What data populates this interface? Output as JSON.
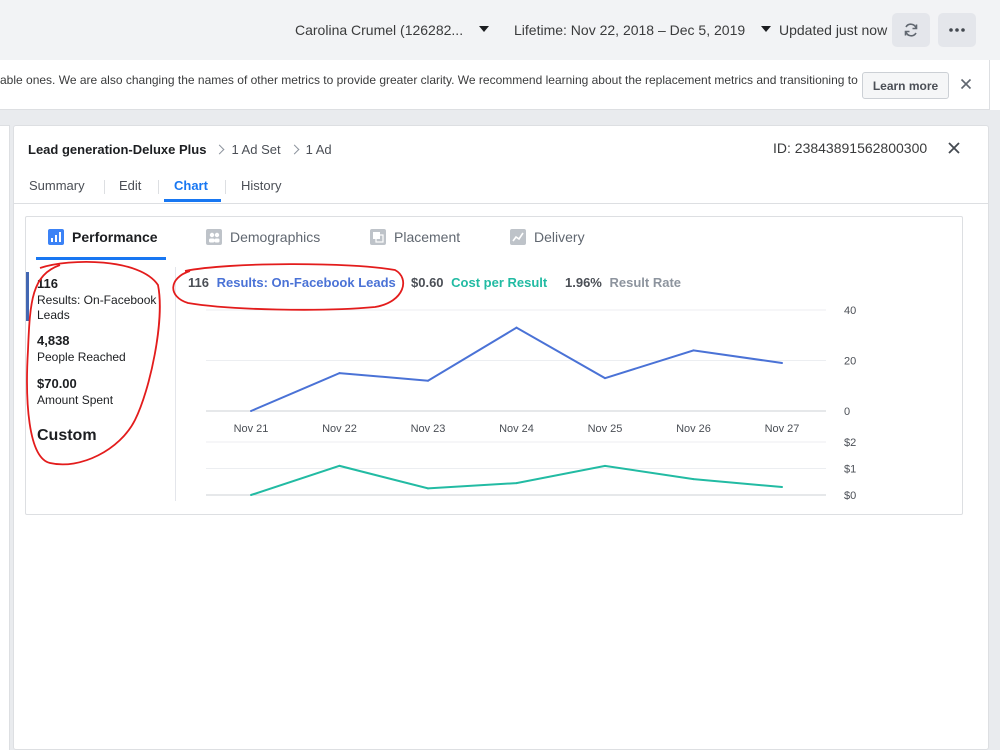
{
  "topbar": {
    "account": "Carolina Crumel (126282...",
    "date_range": "Lifetime: Nov 22, 2018 – Dec 5, 2019",
    "updated": "Updated just now",
    "refresh_icon": "refresh-icon",
    "more_icon": "more-icon"
  },
  "banner": {
    "text": "able ones. We are also changing the names of other metrics to provide greater clarity. We recommend learning about the replacement metrics and transitioning to",
    "learn_more": "Learn more"
  },
  "panel": {
    "breadcrumb": {
      "campaign": "Lead generation-Deluxe Plus",
      "ad_set": "1 Ad Set",
      "ad": "1 Ad"
    },
    "id": "ID: 23843891562800300",
    "tabs": [
      "Summary",
      "Edit",
      "Chart",
      "History"
    ],
    "active_tab": "Chart"
  },
  "chart_tabs": [
    "Performance",
    "Demographics",
    "Placement",
    "Delivery"
  ],
  "stats": [
    {
      "value": "116",
      "label": "Results: On-Facebook Leads"
    },
    {
      "value": "4,838",
      "label": "People Reached"
    },
    {
      "value": "$70.00",
      "label": "Amount Spent"
    }
  ],
  "custom_label": "Custom",
  "summary": {
    "results_value": "116",
    "results_label": "Results: On-Facebook Leads",
    "cpr_value": "$0.60",
    "cpr_label": "Cost per Result",
    "rate_value": "1.96%",
    "rate_label": "Result Rate"
  },
  "colors": {
    "results": "#4a72d6",
    "cost": "#22bba3",
    "accent": "#1877f2",
    "annotation": "#e31c1c"
  },
  "chart_data": [
    {
      "type": "line",
      "categories": [
        "Nov 21",
        "Nov 22",
        "Nov 23",
        "Nov 24",
        "Nov 25",
        "Nov 26",
        "Nov 27"
      ],
      "series": [
        {
          "name": "Results: On-Facebook Leads",
          "values": [
            0,
            15,
            12,
            33,
            13,
            24,
            19
          ]
        }
      ],
      "yticks": [
        "40",
        "20",
        "0"
      ],
      "ylim": [
        0,
        40
      ],
      "grid": true
    },
    {
      "type": "line",
      "categories": [
        "Nov 21",
        "Nov 22",
        "Nov 23",
        "Nov 24",
        "Nov 25",
        "Nov 26",
        "Nov 27"
      ],
      "series": [
        {
          "name": "Cost per Result",
          "values": [
            0,
            1.1,
            0.25,
            0.45,
            1.1,
            0.6,
            0.3
          ]
        }
      ],
      "yticks": [
        "$2",
        "$1",
        "$0"
      ],
      "ylim": [
        0,
        2
      ],
      "grid": true
    }
  ]
}
